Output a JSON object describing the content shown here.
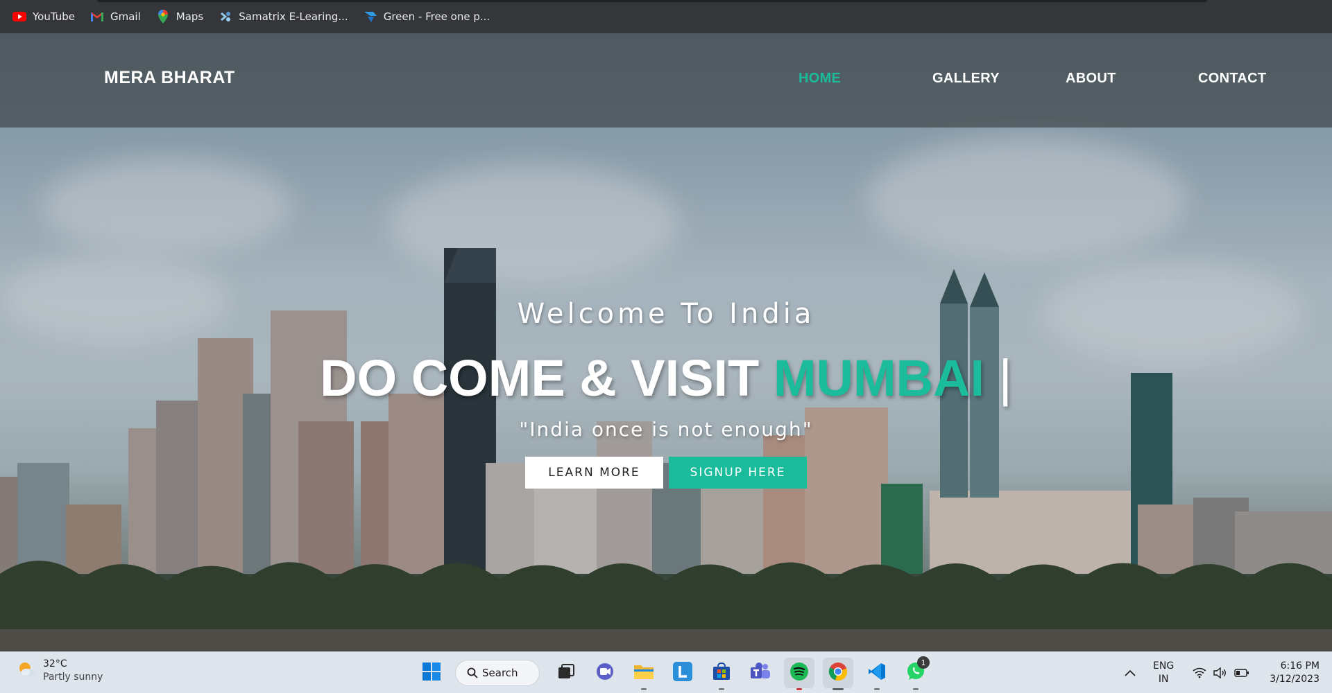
{
  "bookmarks": [
    {
      "label": "YouTube",
      "icon": "youtube-icon"
    },
    {
      "label": "Gmail",
      "icon": "gmail-icon"
    },
    {
      "label": "Maps",
      "icon": "maps-icon"
    },
    {
      "label": "Samatrix E-Learing...",
      "icon": "samatrix-icon"
    },
    {
      "label": "Green - Free one p...",
      "icon": "green-icon"
    }
  ],
  "site": {
    "brand": "MERA BHARAT",
    "nav": [
      "HOME",
      "GALLERY",
      "ABOUT",
      "CONTACT"
    ],
    "active_nav": "HOME",
    "accent_color": "#1abc9c"
  },
  "hero": {
    "welcome": "Welcome To India",
    "headline_prefix": "DO COME & VISIT ",
    "headline_accent": "MUMBAI",
    "headline_cursor": " |",
    "quote": "\"India once is not enough\"",
    "learn_more": "LEARN MORE",
    "signup": "SIGNUP HERE"
  },
  "taskbar": {
    "weather_temp": "32°C",
    "weather_desc": "Partly sunny",
    "search_label": "Search",
    "apps": [
      "start-icon",
      "task-view-icon",
      "chat-icon",
      "file-explorer-icon",
      "l-app-icon",
      "store-icon",
      "teams-icon",
      "spotify-icon",
      "chrome-icon",
      "vscode-icon",
      "whatsapp-icon"
    ],
    "whatsapp_badge": "1",
    "lang_top": "ENG",
    "lang_bottom": "IN",
    "time": "6:16 PM",
    "date": "3/12/2023"
  }
}
